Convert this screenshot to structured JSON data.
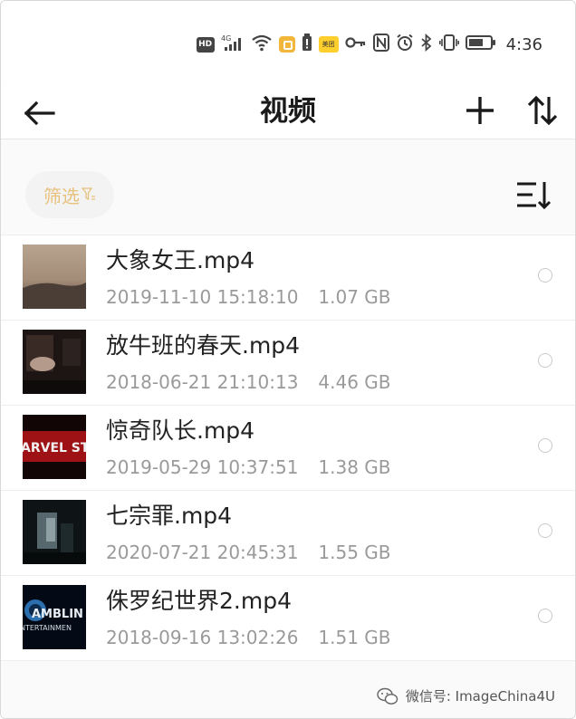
{
  "status_bar": {
    "hd": "HD",
    "network": "4G",
    "meituan": "美团",
    "time": "4:36"
  },
  "header": {
    "title": "视频",
    "back_icon": "arrow-left-icon",
    "add_icon": "plus-icon",
    "sort_icon": "sort-up-down-icon"
  },
  "toolbar": {
    "filter_label": "筛选",
    "filter_icon": "filter-icon",
    "list_sort_icon": "list-sort-icon"
  },
  "files": [
    {
      "name": "大象女王.mp4",
      "datetime": "2019-11-10 15:18:10",
      "size": "1.07 GB",
      "selected": false
    },
    {
      "name": "放牛班的春天.mp4",
      "datetime": "2018-06-21 21:10:13",
      "size": "4.46 GB",
      "selected": false
    },
    {
      "name": "惊奇队长.mp4",
      "datetime": "2019-05-29 10:37:51",
      "size": "1.38 GB",
      "selected": false
    },
    {
      "name": "七宗罪.mp4",
      "datetime": "2020-07-21 20:45:31",
      "size": "1.55 GB",
      "selected": false
    },
    {
      "name": "侏罗纪世界2.mp4",
      "datetime": "2018-09-16 13:02:26",
      "size": "1.51 GB",
      "selected": false
    }
  ],
  "thumbnails": {
    "thumb3_text": "ARVEL STUD",
    "thumb5_text_top": "AMBLIN",
    "thumb5_text_bottom": "NTERTAINMEN"
  },
  "watermark": {
    "text": "微信号: ImageChina4U"
  },
  "colors": {
    "accent": "#e7c17c",
    "meta_gray": "#9a9a9a",
    "title": "#1a1a1a"
  }
}
